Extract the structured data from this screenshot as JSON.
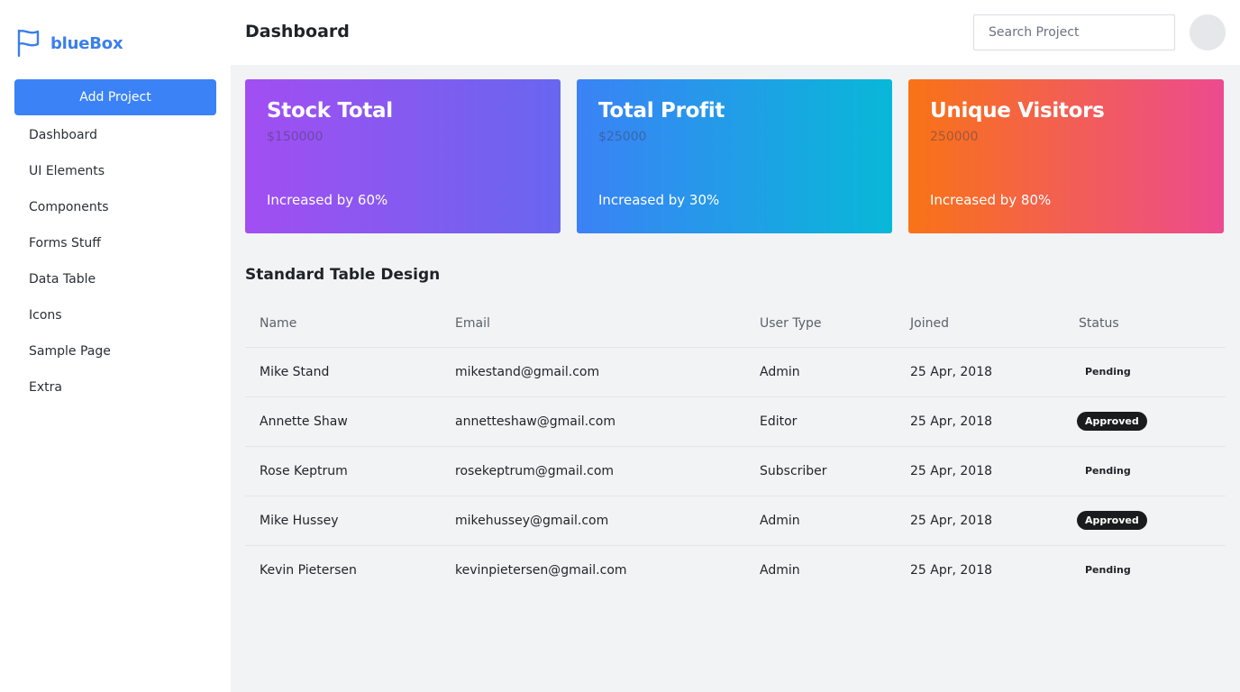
{
  "app": {
    "brand": "blueBox",
    "brand_color": "#3b7fea"
  },
  "sidebar": {
    "add_project_label": "Add Project",
    "items": [
      {
        "label": "Dashboard"
      },
      {
        "label": "UI Elements"
      },
      {
        "label": "Components"
      },
      {
        "label": "Forms Stuff"
      },
      {
        "label": "Data Table"
      },
      {
        "label": "Icons"
      },
      {
        "label": "Sample Page"
      },
      {
        "label": "Extra"
      }
    ]
  },
  "header": {
    "title": "Dashboard",
    "search_placeholder": "Search Project"
  },
  "cards": [
    {
      "title": "Stock Total",
      "value": "$150000",
      "footer": "Increased by 60%"
    },
    {
      "title": "Total Profit",
      "value": "$25000",
      "footer": "Increased by 30%"
    },
    {
      "title": "Unique Visitors",
      "value": "250000",
      "footer": "Increased by 80%"
    }
  ],
  "table": {
    "title": "Standard Table Design",
    "headers": [
      "Name",
      "Email",
      "User Type",
      "Joined",
      "Status"
    ],
    "rows": [
      {
        "name": "Mike Stand",
        "email": "mikestand@gmail.com",
        "type": "Admin",
        "joined": "25 Apr, 2018",
        "status": "Pending"
      },
      {
        "name": "Annette Shaw",
        "email": "annetteshaw@gmail.com",
        "type": "Editor",
        "joined": "25 Apr, 2018",
        "status": "Approved"
      },
      {
        "name": "Rose Keptrum",
        "email": "rosekeptrum@gmail.com",
        "type": "Subscriber",
        "joined": "25 Apr, 2018",
        "status": "Pending"
      },
      {
        "name": "Mike Hussey",
        "email": "mikehussey@gmail.com",
        "type": "Admin",
        "joined": "25 Apr, 2018",
        "status": "Approved"
      },
      {
        "name": "Kevin Pietersen",
        "email": "kevinpietersen@gmail.com",
        "type": "Admin",
        "joined": "25 Apr, 2018",
        "status": "Pending"
      }
    ]
  }
}
